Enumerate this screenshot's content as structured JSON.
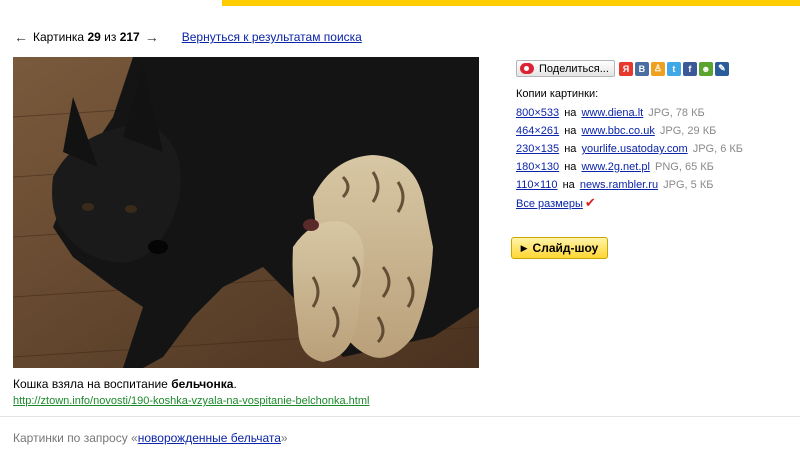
{
  "nav": {
    "prev_arrow": "←",
    "next_arrow": "→",
    "counter_prefix": "Картинка",
    "current": "29",
    "of": "из",
    "total": "217",
    "back_link": "Вернуться к результатам поиска"
  },
  "caption": {
    "text_prefix": "Кошка взяла на воспитание ",
    "text_bold": "бельчонка",
    "text_suffix": ".",
    "source_url": "http://ztown.info/novosti/190-koshka-vzyala-na-vospitanie-belchonka.html"
  },
  "share": {
    "button_label": "Поделиться...",
    "icons": [
      {
        "name": "yaru-icon",
        "glyph": "Я",
        "color": "#e8382c"
      },
      {
        "name": "vkontakte-icon",
        "glyph": "В",
        "color": "#4a6ea0"
      },
      {
        "name": "moikrug-icon",
        "glyph": "♙",
        "color": "#f0a020"
      },
      {
        "name": "twitter-icon",
        "glyph": "t",
        "color": "#3fa9e8"
      },
      {
        "name": "facebook-icon",
        "glyph": "f",
        "color": "#3b5998"
      },
      {
        "name": "odnoklassniki-icon",
        "glyph": "☻",
        "color": "#5aa530"
      },
      {
        "name": "livejournal-icon",
        "glyph": "✎",
        "color": "#2b5c9a"
      }
    ]
  },
  "copies": {
    "title": "Копии картинки:",
    "na": "на",
    "items": [
      {
        "size": "800×533",
        "site": "www.diena.lt",
        "meta": "JPG, 78 КБ"
      },
      {
        "size": "464×261",
        "site": "www.bbc.co.uk",
        "meta": "JPG, 29 КБ"
      },
      {
        "size": "230×135",
        "site": "yourlife.usatoday.com",
        "meta": "JPG, 6 КБ"
      },
      {
        "size": "180×130",
        "site": "www.2g.net.pl",
        "meta": "PNG, 65 КБ"
      },
      {
        "size": "110×110",
        "site": "news.rambler.ru",
        "meta": "JPG, 5 КБ"
      }
    ],
    "all_sizes": "Все размеры",
    "checkmark": "✔"
  },
  "slideshow": {
    "play_glyph": "▶",
    "label": "Слайд-шоу"
  },
  "query": {
    "prefix": "Картинки по запросу «",
    "link": "новорожденные бельчата",
    "suffix": "»"
  }
}
